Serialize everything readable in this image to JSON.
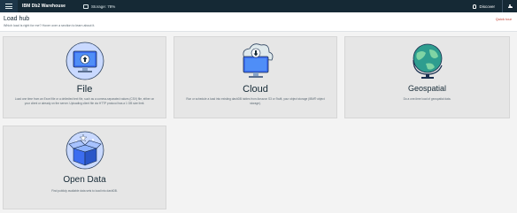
{
  "topbar": {
    "app_title": "IBM Db2 Warehouse",
    "storage_label": "Storage: 78%",
    "discover_label": "Discover"
  },
  "header": {
    "title": "Load hub",
    "subtitle": "Which load is right for me? Hover over a section to learn about it.",
    "quick_tour": "Quick tour"
  },
  "cards": {
    "file": {
      "title": "File",
      "description": "Load one time from an Excel file or a delimited text file, such as a comma-separated values (CSV) file, either on your client or already on the server. Uploading client file via HTTP protocol has a 1 GB size limit.",
      "icon": "monitor-upload-icon"
    },
    "cloud": {
      "title": "Cloud",
      "description": "Run or schedule a load into existing dashDB tables from Amazon S3 or Swift, your object storage (IBM® object storage).",
      "icon": "cloud-download-icon"
    },
    "geospatial": {
      "title": "Geospatial",
      "description": "Do a one-time load of geospatial data.",
      "icon": "globe-icon"
    },
    "open_data": {
      "title": "Open Data",
      "description": "Find publicly available data sets to load into dashDB.",
      "icon": "open-box-icon"
    }
  },
  "colors": {
    "topbar": "#152935",
    "accent": "#c0392b",
    "illustration_blue": "#3c6df0"
  }
}
